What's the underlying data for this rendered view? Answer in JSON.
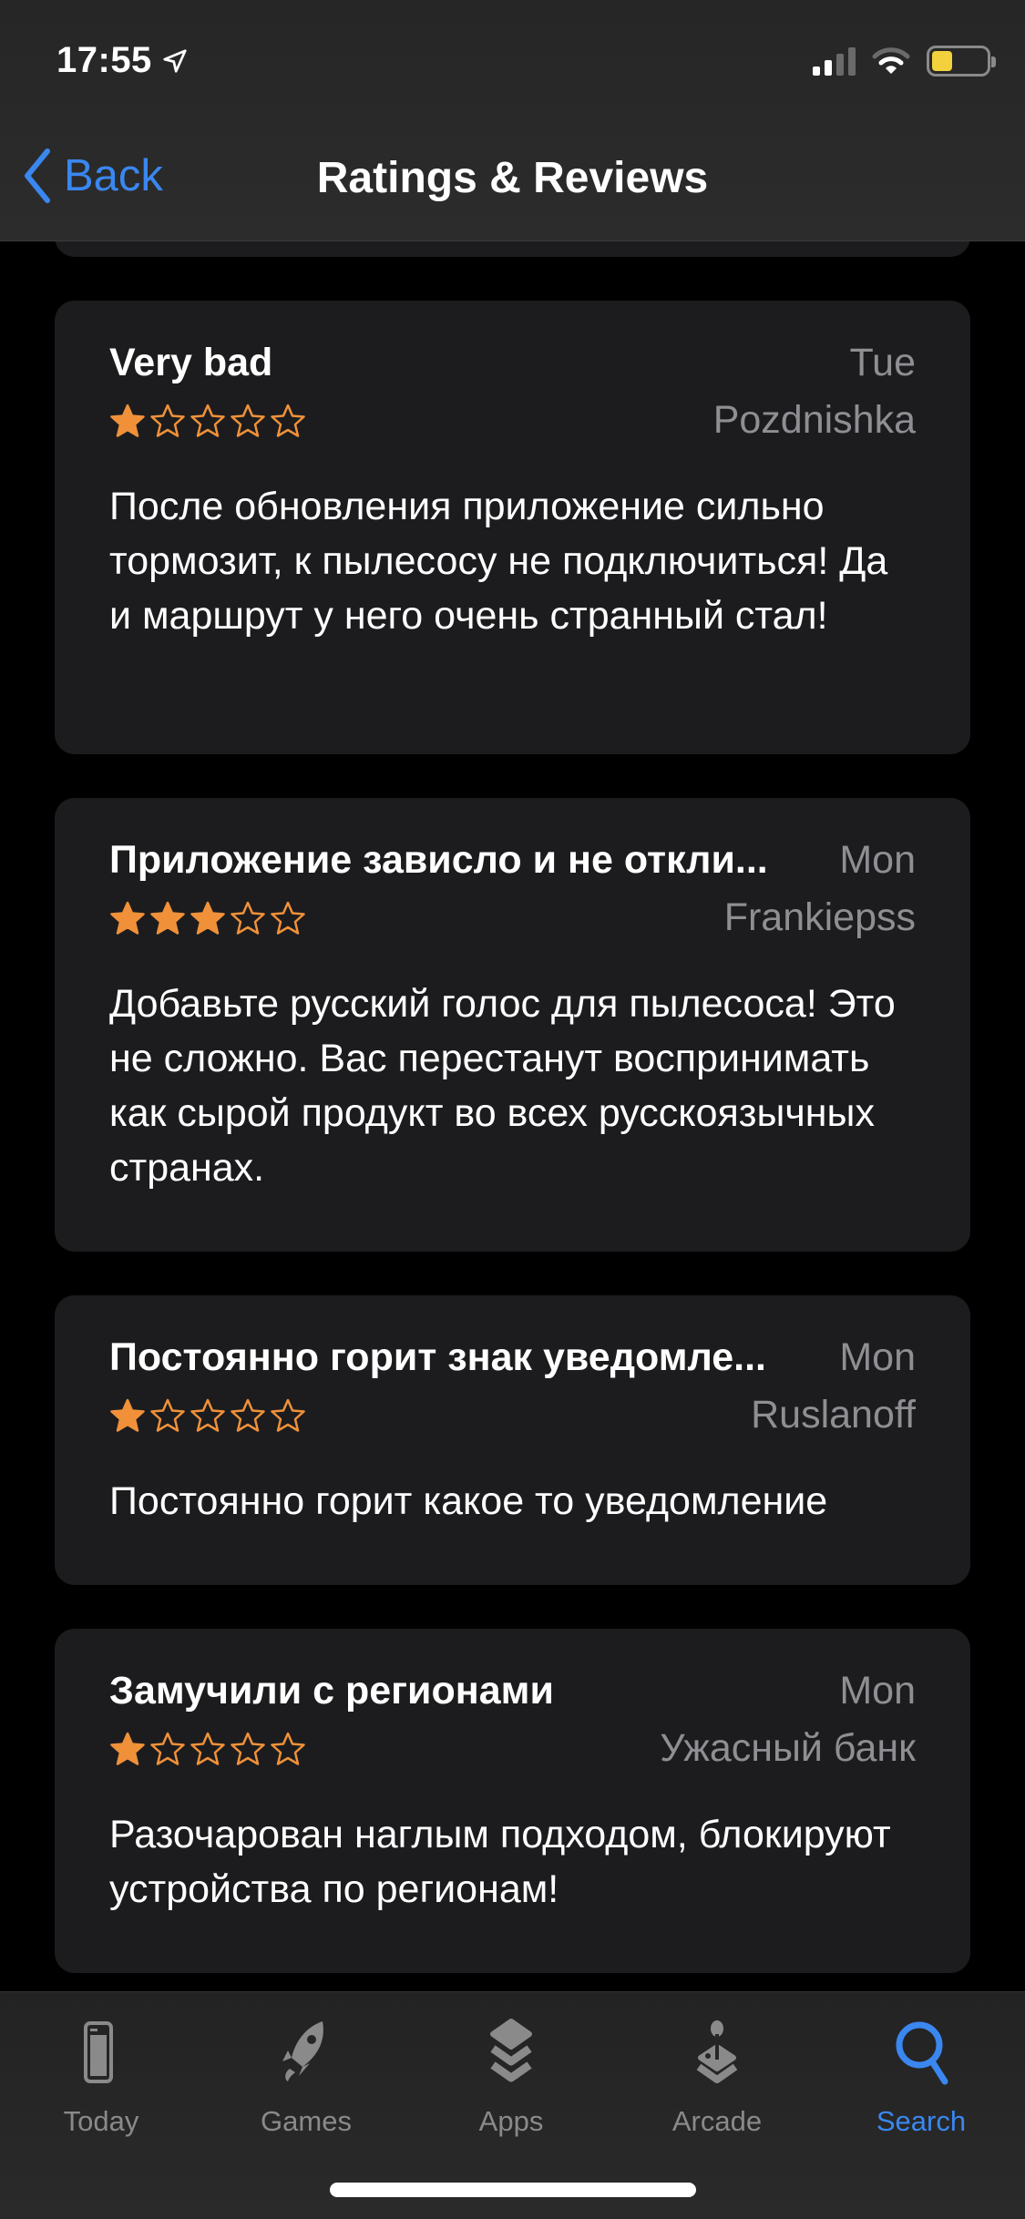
{
  "status_bar": {
    "time": "17:55",
    "location_icon": "location-arrow-icon",
    "signal_bars_active": 2,
    "signal_bars_total": 4,
    "wifi_icon": "wifi-icon",
    "battery_level_percent": 30,
    "battery_color": "#f2d13c"
  },
  "nav": {
    "back_label": "Back",
    "title": "Ratings & Reviews",
    "accent_color": "#3a87f0"
  },
  "reviews": [
    {
      "title": "Very bad",
      "date": "Tue",
      "author": "Pozdnishka",
      "rating": 1,
      "max_rating": 5,
      "body": "После обновления приложение сильно тормозит, к пылесосу не подключиться! Да и маршрут у него очень странный стал!"
    },
    {
      "title": "Приложение зависло и не откли...",
      "date": "Mon",
      "author": "Frankiepss",
      "rating": 3,
      "max_rating": 5,
      "body": "Добавьте русский голос для пылесоса! Это не сложно. Вас перестанут воспринимать как сырой продукт во всех русскоязычных странах."
    },
    {
      "title": "Постоянно горит знак уведомле...",
      "date": "Mon",
      "author": "Ruslanoff",
      "rating": 1,
      "max_rating": 5,
      "body": "Постоянно горит какое то уведомление"
    },
    {
      "title": "Замучили с регионами",
      "date": "Mon",
      "author": "Ужасный банк",
      "rating": 1,
      "max_rating": 5,
      "body": "Разочарован наглым подходом, блокируют устройства по регионам!"
    }
  ],
  "star_color": "#f0913a",
  "tabbar": {
    "items": [
      {
        "label": "Today",
        "icon": "today-icon",
        "active": false
      },
      {
        "label": "Games",
        "icon": "rocket-icon",
        "active": false
      },
      {
        "label": "Apps",
        "icon": "layers-icon",
        "active": false
      },
      {
        "label": "Arcade",
        "icon": "joystick-icon",
        "active": false
      },
      {
        "label": "Search",
        "icon": "search-icon",
        "active": true
      }
    ]
  }
}
